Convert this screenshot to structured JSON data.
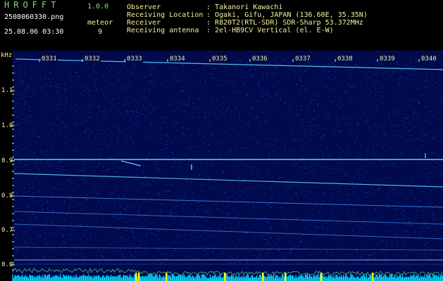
{
  "header": {
    "logo": "HROFFT",
    "version": "1.0.0",
    "file_name": "2508060330.png",
    "timestamp": "25.08.06 03:30",
    "meteor_label": "meteor",
    "meteor_count": "9"
  },
  "station": [
    {
      "key": "Observer",
      "sep": ": ",
      "value": "Takanori Kawachi"
    },
    {
      "key": "Receiving Location",
      "sep": ": ",
      "value": "Ogaki, Gifu, JAPAN (136.60E, 35.35N)"
    },
    {
      "key": "Receiver",
      "sep": ": ",
      "value": "R820T2(RTL-SDR) SDR-Sharp 53.372MHz"
    },
    {
      "key": "Receiving antenna",
      "sep": ": ",
      "value": "2el-HB9CV Vertical (el. E-W)"
    }
  ],
  "spectrogram": {
    "freq_unit": "kHz",
    "freq_ticks": [
      "1.1",
      "1.0",
      "0.9",
      "0.8",
      "0.7",
      "0.6"
    ],
    "time_ticks": [
      "0331",
      "0332",
      "0333",
      "0334",
      "0335",
      "0336",
      "0337",
      "0338",
      "0339",
      "0340"
    ],
    "colors": {
      "background": "#000a4c",
      "noise": "#2a3cc8",
      "signal": "#59d0ff",
      "power_trace": "#00e5ff",
      "marker": "#ffff00"
    }
  }
}
